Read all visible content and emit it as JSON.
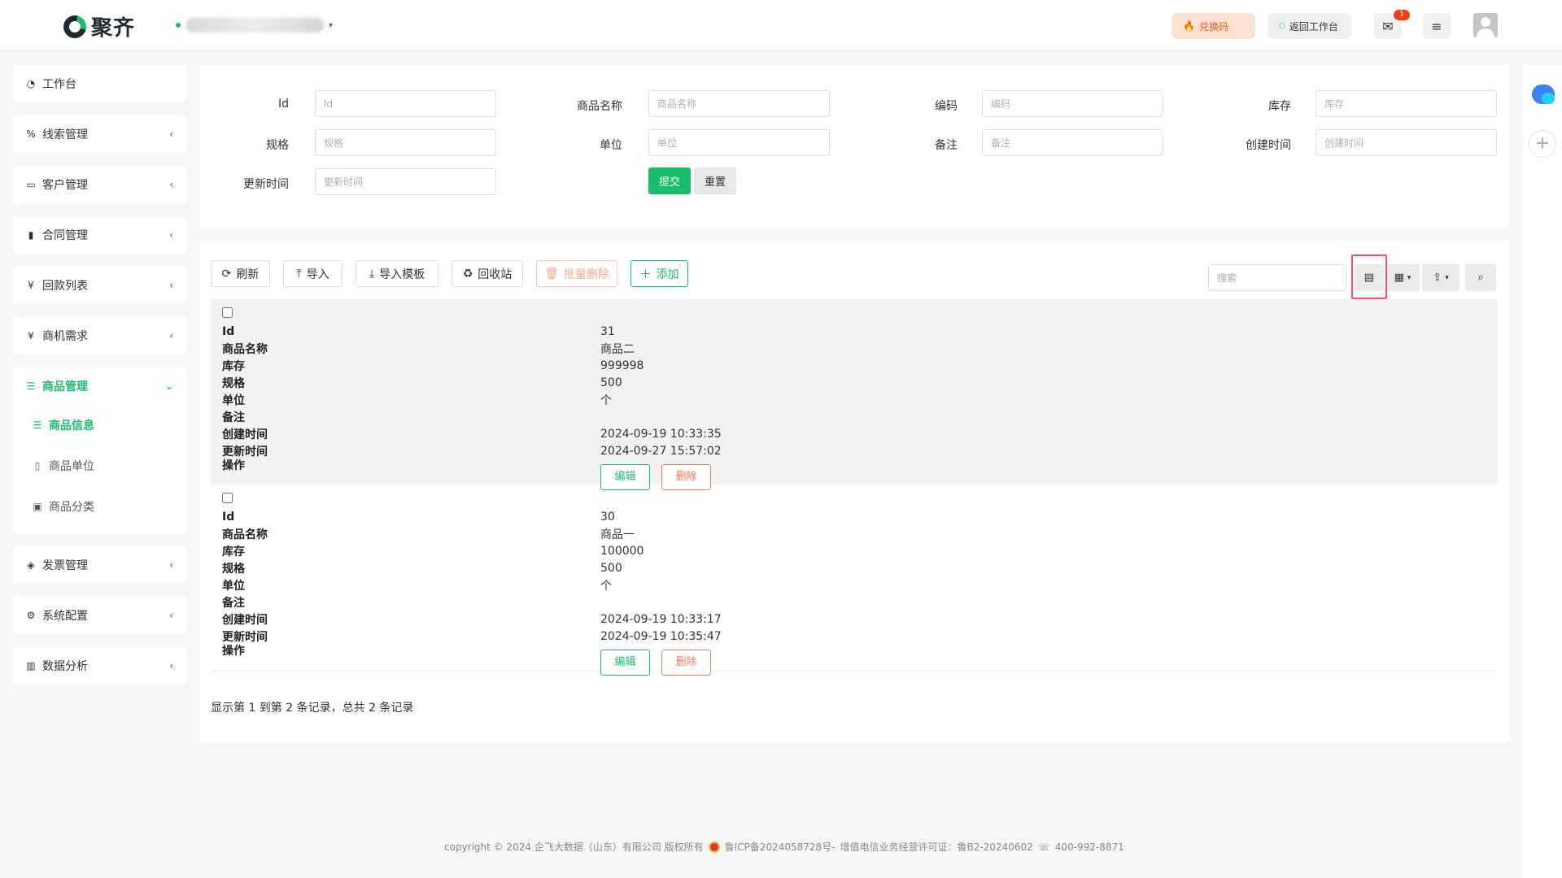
{
  "header": {
    "logo_text": "聚齐",
    "redeem_label": "兑换码",
    "back_label": "返回工作台",
    "mail_badge": "1"
  },
  "sidebar": {
    "items": [
      {
        "label": "工作台",
        "icon": "dashboard-icon"
      },
      {
        "label": "线索管理",
        "icon": "link-icon"
      },
      {
        "label": "客户管理",
        "icon": "id-card-icon"
      },
      {
        "label": "合同管理",
        "icon": "bookmark-icon"
      },
      {
        "label": "回款列表",
        "icon": "yen-icon"
      },
      {
        "label": "商机需求",
        "icon": "yen-icon"
      }
    ],
    "active_group": {
      "label": "商品管理",
      "children": [
        {
          "label": "商品信息",
          "active": true
        },
        {
          "label": "商品单位",
          "active": false
        },
        {
          "label": "商品分类",
          "active": false
        }
      ]
    },
    "items_after": [
      {
        "label": "发票管理",
        "icon": "tag-icon"
      },
      {
        "label": "系统配置",
        "icon": "gears-icon"
      },
      {
        "label": "数据分析",
        "icon": "bar-chart-icon"
      }
    ]
  },
  "search_form": {
    "fields": [
      {
        "label": "Id",
        "placeholder": "Id"
      },
      {
        "label": "商品名称",
        "placeholder": "商品名称"
      },
      {
        "label": "编码",
        "placeholder": "编码"
      },
      {
        "label": "库存",
        "placeholder": "库存"
      },
      {
        "label": "规格",
        "placeholder": "规格"
      },
      {
        "label": "单位",
        "placeholder": "单位"
      },
      {
        "label": "备注",
        "placeholder": "备注"
      },
      {
        "label": "创建时间",
        "placeholder": "创建时间"
      },
      {
        "label": "更新时间",
        "placeholder": "更新时间"
      }
    ],
    "submit_label": "提交",
    "reset_label": "重置"
  },
  "toolbar": {
    "refresh": "刷新",
    "import": "导入",
    "import_template": "导入模板",
    "recycle": "回收站",
    "batch_delete": "批量删除",
    "add": "添加",
    "search_placeholder": "搜索"
  },
  "table": {
    "field_labels": [
      "Id",
      "商品名称",
      "库存",
      "规格",
      "单位",
      "备注",
      "创建时间",
      "更新时间",
      "操作"
    ],
    "rows": [
      {
        "id": "31",
        "name": "商品二",
        "stock": "999998",
        "spec": "500",
        "unit": "个",
        "remark": "",
        "created": "2024-09-19 10:33:35",
        "updated": "2024-09-27 15:57:02"
      },
      {
        "id": "30",
        "name": "商品一",
        "stock": "100000",
        "spec": "500",
        "unit": "个",
        "remark": "",
        "created": "2024-09-19 10:33:17",
        "updated": "2024-09-19 10:35:47"
      }
    ],
    "edit_label": "编辑",
    "delete_label": "删除",
    "summary": "显示第 1 到第 2 条记录，总共 2 条记录"
  },
  "footer": {
    "copyright": "copyright © 2024 企飞大数据（山东）有限公司 版权所有",
    "icp": "鲁ICP备2024058728号-",
    "license": "增值电信业务经营许可证：鲁B2-20240602",
    "phone": "400-992-8871"
  },
  "colors": {
    "accent": "#19be6b",
    "danger": "#f07b5c",
    "highlight": "#ff4d6a"
  }
}
